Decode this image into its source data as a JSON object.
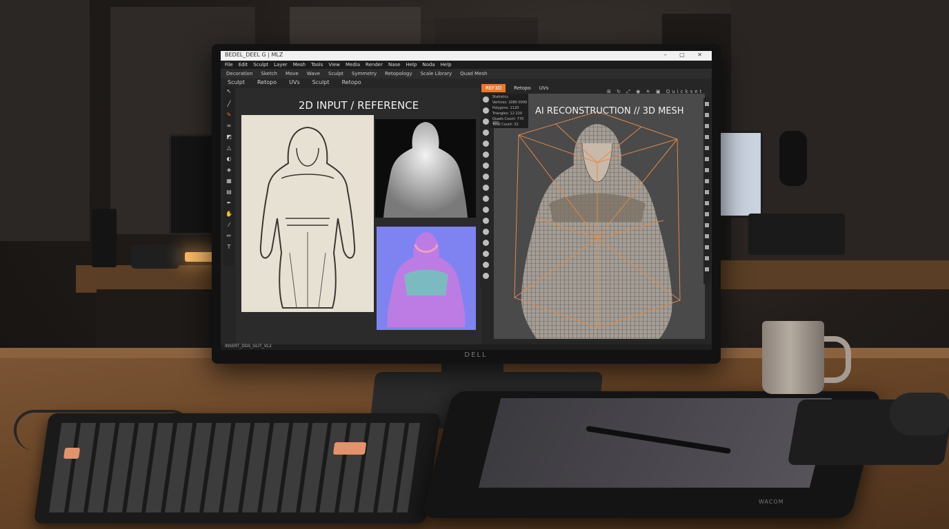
{
  "scene": {
    "monitor_brand": "DELL",
    "tablet_brand": "WACOM"
  },
  "app": {
    "window_title": "BEDEL_DEEL G | MLZ",
    "window_controls": "– ▢ ✕",
    "menu": [
      "File",
      "Edit",
      "Sculpt",
      "Layer",
      "Mesh",
      "Tools",
      "View",
      "Media",
      "Render",
      "Nase",
      "Help",
      "Noda",
      "Help"
    ],
    "toolbar": [
      "Decoration",
      "Sketch",
      "Move",
      "Wave",
      "Sculpt",
      "Symmetry",
      "Retopology",
      "Scale Library",
      "Quad Mesh"
    ],
    "left_tabs": [
      "Sculpt",
      "Retopo",
      "UVs",
      "Sculpt",
      "Retopo"
    ],
    "right_tabs": [
      "REF3D",
      "Retopo",
      "UVs"
    ],
    "right_tabs_active": "REF3D",
    "right_tool_label": "Quickset",
    "left_panel_title": "2D INPUT / REFERENCE",
    "right_panel_title": "AI RECONSTRUCTION // 3D MESH",
    "info": [
      "Statistics",
      "Vertices: 1080 0000",
      "Polygons: 1120",
      "Triangles: 12 220",
      "Quads Count: 770 280",
      "Total Count: 32"
    ],
    "status": "INSERT_DDS_GLIT_VL2"
  },
  "colors": {
    "accent": "#e8782c",
    "wireframe": "#e08a4a",
    "normal_map": "#7f83f2"
  }
}
